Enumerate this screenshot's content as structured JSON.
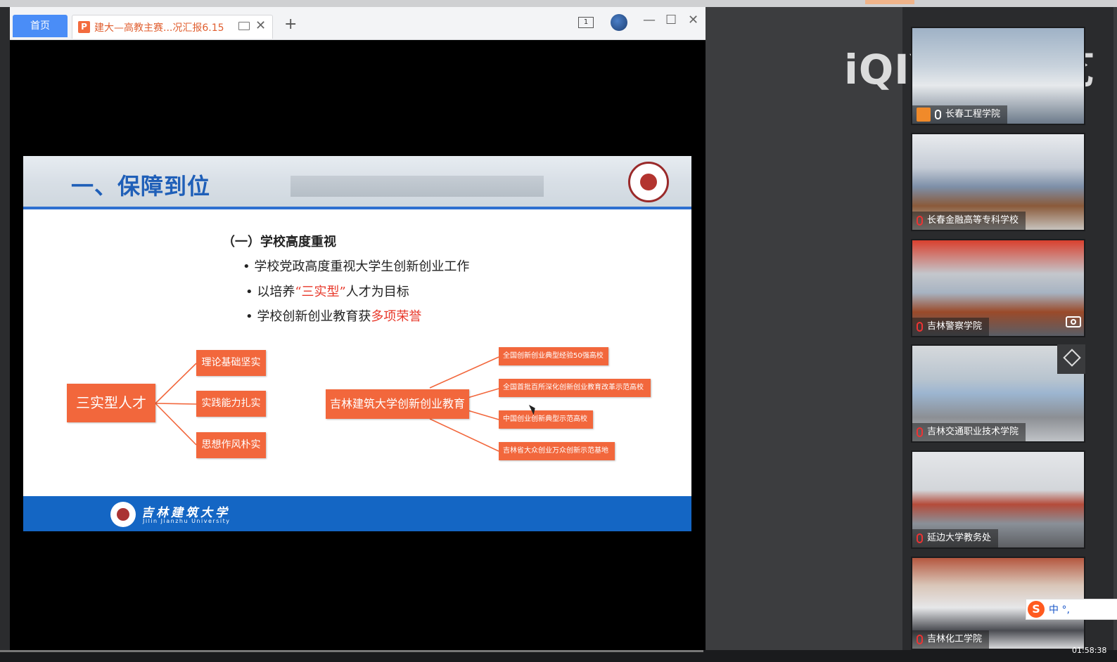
{
  "viewer": {
    "home_tab": "首页",
    "doc_tab_icon": "P",
    "doc_tab_title": "建大—高教主赛...况汇报6.15",
    "page_indicator": "1"
  },
  "slide": {
    "heading": "一、保障到位",
    "section_title": "（一）学校高度重视",
    "bullets": [
      {
        "text": "• 学校党政高度重视大学生创新创业工作"
      },
      {
        "pre": "• 以培养",
        "red": "“三实型”",
        "post": "人才为目标"
      },
      {
        "pre": "• 学校创新创业教育获",
        "red": "多项荣誉"
      }
    ],
    "left_root": "三实型人才",
    "left_branches": [
      "理论基础坚实",
      "实践能力扎实",
      "思想作风朴实"
    ],
    "right_root": "吉林建筑大学创新创业教育",
    "right_branches": [
      "全国创新创业典型经验50强高校",
      "全国首批百所深化创新创业教育改革示范高校",
      "中国创业创新典型示范高校",
      "吉林省大众创业万众创新示范基地"
    ],
    "footer_cn": "吉林建筑大学",
    "footer_en": "Jilin Jianzhu University"
  },
  "watermark": "iQIYI 爱奇艺",
  "participants": [
    {
      "name": "长春工程学院",
      "icon": "person-icon",
      "mic": "active"
    },
    {
      "name": "长春金融高等专科学校",
      "mic": "muted"
    },
    {
      "name": "吉林警察学院",
      "mic": "muted"
    },
    {
      "name": "吉林交通职业技术学院",
      "mic": "muted"
    },
    {
      "name": "延边大学教务处",
      "mic": "muted"
    },
    {
      "name": "吉林化工学院",
      "mic": "muted"
    }
  ],
  "ime": {
    "logo": "S",
    "mode": "中 °,"
  },
  "clock": "01:58:38",
  "colors": {
    "accent_orange": "#f2673c",
    "slide_blue": "#1466c4",
    "highlight_red": "#e8382a"
  }
}
